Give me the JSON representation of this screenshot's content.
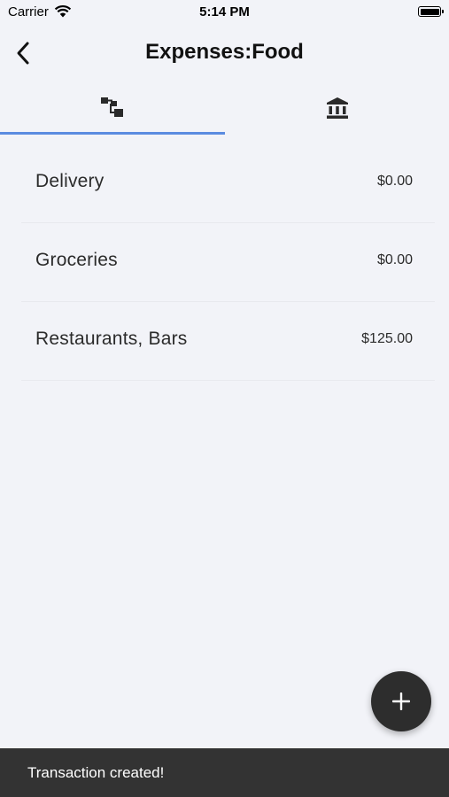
{
  "status_bar": {
    "carrier": "Carrier",
    "time": "5:14 PM",
    "icons": [
      "wifi-icon",
      "battery-icon"
    ]
  },
  "nav": {
    "title": "Expenses:Food",
    "back_icon": "chevron-left-icon"
  },
  "tabs": [
    {
      "icon": "account-tree-icon",
      "selected": true
    },
    {
      "icon": "bank-icon",
      "selected": false
    }
  ],
  "accent_color": "#5b8be0",
  "accounts": [
    {
      "name": "Delivery",
      "amount": "$0.00"
    },
    {
      "name": "Groceries",
      "amount": "$0.00"
    },
    {
      "name": "Restaurants, Bars",
      "amount": "$125.00"
    }
  ],
  "fab": {
    "icon": "plus-icon",
    "color": "#2d2d2d"
  },
  "snackbar": {
    "message": "Transaction created!"
  }
}
